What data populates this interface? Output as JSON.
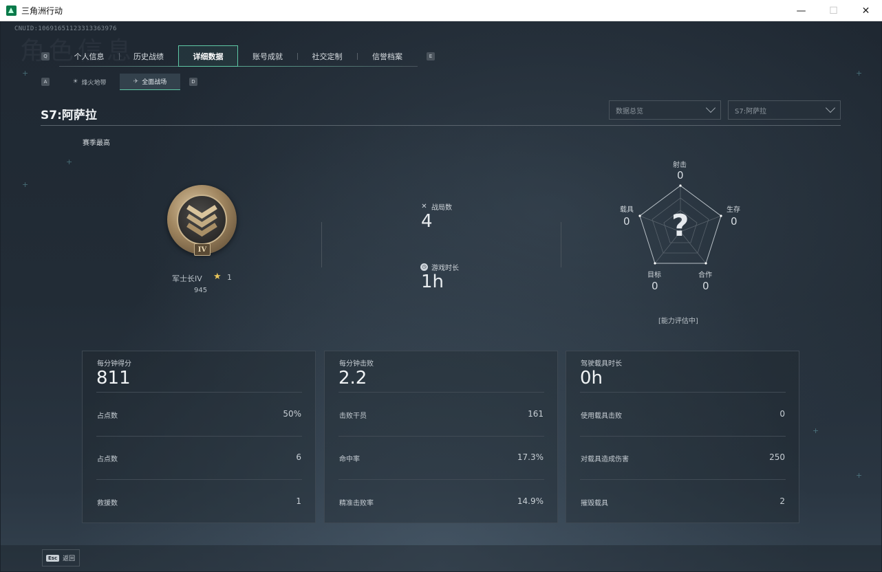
{
  "window": {
    "title": "三角洲行动",
    "minimize_glyph": "—",
    "maximize_glyph": "☐",
    "close_glyph": "✕"
  },
  "header": {
    "cnuid": "CNUID:10691651123313363976",
    "ghost_title": "角色信息"
  },
  "key_hints": {
    "prev_tab": "Q",
    "next_tab": "E",
    "prev_sub": "A",
    "next_sub": "D"
  },
  "main_tabs": [
    {
      "label": "个人信息",
      "active": false
    },
    {
      "label": "历史战绩",
      "active": false
    },
    {
      "label": "详细数据",
      "active": true
    },
    {
      "label": "账号成就",
      "active": false
    },
    {
      "label": "社交定制",
      "active": false
    },
    {
      "label": "信誉档案",
      "active": false
    }
  ],
  "sub_tabs": [
    {
      "label": "烽火地带",
      "icon": "beacon-icon",
      "active": false
    },
    {
      "label": "全面战场",
      "icon": "battlefield-icon",
      "active": true
    }
  ],
  "season": {
    "title": "S7:阿萨拉",
    "dropdown_view": "数据总览",
    "dropdown_season": "S7:阿萨拉",
    "best_label": "赛季最高"
  },
  "rank": {
    "name": "军士长IV",
    "numeral": "IV",
    "stars": "1",
    "points": "945",
    "star_color": "#e8c55a"
  },
  "matches": {
    "games_label": "战局数",
    "games_value": "4",
    "time_label": "游戏时长",
    "time_value": "1h"
  },
  "radar": {
    "axes": [
      {
        "label": "射击",
        "value": "0"
      },
      {
        "label": "生存",
        "value": "0"
      },
      {
        "label": "合作",
        "value": "0"
      },
      {
        "label": "目标",
        "value": "0"
      },
      {
        "label": "载具",
        "value": "0"
      }
    ],
    "placeholder": "?",
    "status": "[能力评估中]"
  },
  "cards": [
    {
      "title": "每分钟得分",
      "big": "811",
      "rows": [
        {
          "label": "占点数",
          "value": "50%"
        },
        {
          "label": "占点数",
          "value": "6"
        },
        {
          "label": "救援数",
          "value": "1"
        }
      ]
    },
    {
      "title": "每分钟击败",
      "big": "2.2",
      "rows": [
        {
          "label": "击败干员",
          "value": "161"
        },
        {
          "label": "命中率",
          "value": "17.3%"
        },
        {
          "label": "精准击败率",
          "value": "14.9%"
        }
      ]
    },
    {
      "title": "驾驶载具时长",
      "big": "0h",
      "rows": [
        {
          "label": "使用载具击败",
          "value": "0"
        },
        {
          "label": "对载具造成伤害",
          "value": "250"
        },
        {
          "label": "摧毁载具",
          "value": "2"
        }
      ]
    }
  ],
  "footer": {
    "esc_key": "Esc",
    "back_label": "返回"
  },
  "colors": {
    "accent": "#5fc9a6",
    "gold": "#c9b48e"
  }
}
